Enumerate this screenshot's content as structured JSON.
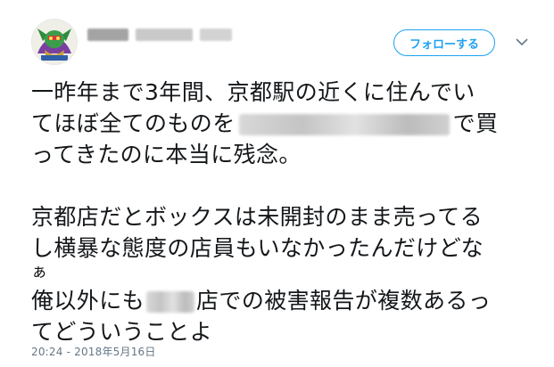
{
  "follow_button": {
    "label": "フォローする"
  },
  "tweet": {
    "line1": "一昨年まで3年間、京都駅の近くに住んでい",
    "line2_before": "てほぼ全てのものを",
    "line2_after": "で買",
    "line3": "ってきたのに本当に残念。",
    "line4": "京都店だとボックスは未開封のまま売ってる",
    "line5": "し横暴な態度の店員もいなかったんだけどな",
    "line6": "ぁ",
    "line7_before": "俺以外にも",
    "line7_after": "店での被害報告が複数あるっ",
    "line8": "てどういうことよ"
  },
  "timestamp": "20:24 - 2018年5月16日",
  "icons": {
    "avatar": "character-avatar",
    "menu": "chevron-down-icon"
  },
  "colors": {
    "accent": "#1da1f2",
    "text": "#14171a",
    "muted": "#657786"
  }
}
